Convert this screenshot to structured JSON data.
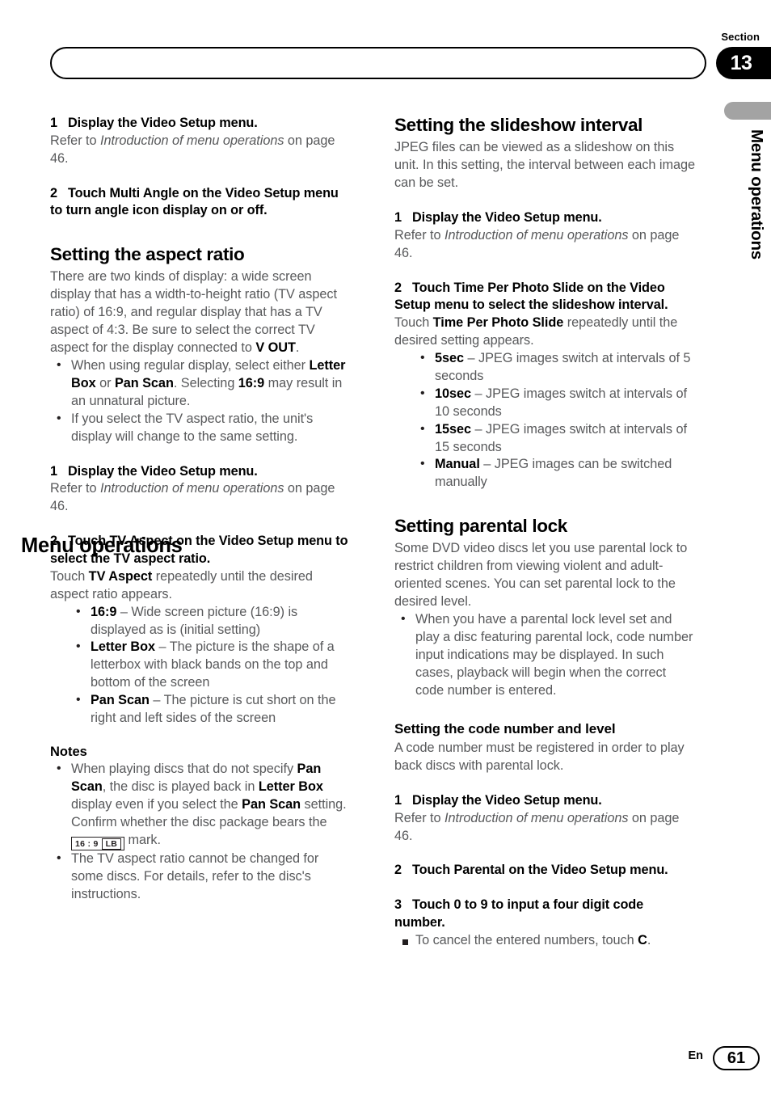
{
  "header": {
    "section_label": "Section",
    "section_number": "13",
    "title": "Menu operations",
    "side_tab_text": "Menu operations"
  },
  "footer": {
    "language": "En",
    "page_number": "61"
  },
  "left_column": {
    "step1_heading": "1    Display the Video Setup menu.",
    "step1_num": "1",
    "step1_text": "Display the Video Setup menu.",
    "step1_refer_pre": "Refer to ",
    "step1_refer_italic": "Introduction of menu operations",
    "step1_refer_post": " on page 46.",
    "step2_num": "2",
    "step2_text": "Touch Multi Angle on the Video Setup menu to turn angle icon display on or off.",
    "aspect_heading": "Setting the aspect ratio",
    "aspect_intro_a": "There are two kinds of display: a wide screen display that has a width-to-height ratio (TV aspect ratio) of 16:9, and regular display that has a TV aspect of 4:3. Be sure to select the correct TV aspect for the display connected to ",
    "aspect_intro_bold": "V OUT",
    "aspect_intro_b": ".",
    "bullet1_a": "When using regular display, select either ",
    "bullet1_b1": "Letter Box",
    "bullet1_c": " or ",
    "bullet1_b2": "Pan Scan",
    "bullet1_d": ". Selecting ",
    "bullet1_b3": "16:9",
    "bullet1_e": " may result in an unnatural picture.",
    "bullet2": "If you select the TV aspect ratio, the unit's display will change to the same setting.",
    "step1b_num": "1",
    "step1b_text": "Display the Video Setup menu.",
    "step1b_refer_pre": "Refer to ",
    "step1b_refer_italic": "Introduction of menu operations",
    "step1b_refer_post": " on page 46.",
    "step2b_num": "2",
    "step2b_text": "Touch TV Aspect on the Video Setup menu to select the TV aspect ratio.",
    "step2b_sub_a": "Touch ",
    "step2b_sub_bold": "TV Aspect",
    "step2b_sub_b": " repeatedly until the desired aspect ratio appears.",
    "options": [
      {
        "term": "16:9",
        "desc": " – Wide screen picture (16:9) is displayed as is (initial setting)"
      },
      {
        "term": "Letter Box",
        "desc": " – The picture is the shape of a letterbox with black bands on the top and bottom of the screen"
      },
      {
        "term": "Pan Scan",
        "desc": " – The picture is cut short on the right and left sides of the screen"
      }
    ],
    "notes_heading": "Notes",
    "note1_a": "When playing discs that do not specify ",
    "note1_b1": "Pan Scan",
    "note1_b": ", the disc is played back in ",
    "note1_b2": "Letter Box",
    "note1_c": " display even if you select the ",
    "note1_b3": "Pan Scan",
    "note1_d": " setting. Confirm whether the disc package bears the ",
    "note1_mark_ratio": "16 : 9",
    "note1_mark_lb": "LB",
    "note1_e": " mark.",
    "note2": "The TV aspect ratio cannot be changed for some discs. For details, refer to the disc's instructions."
  },
  "right_column": {
    "slideshow_heading": "Setting the slideshow interval",
    "slideshow_intro": "JPEG files can be viewed as a slideshow on this unit. In this setting, the interval between each image can be set.",
    "step1_num": "1",
    "step1_text": "Display the Video Setup menu.",
    "step1_refer_pre": "Refer to ",
    "step1_refer_italic": "Introduction of menu operations",
    "step1_refer_post": " on page 46.",
    "step2_num": "2",
    "step2_text": "Touch Time Per Photo Slide on the Video Setup menu to select the slideshow interval.",
    "step2_sub_a": "Touch ",
    "step2_sub_bold": "Time Per Photo Slide",
    "step2_sub_b": " repeatedly until the desired setting appears.",
    "intervals": [
      {
        "term": "5sec",
        "desc": " – JPEG images switch at intervals of 5 seconds"
      },
      {
        "term": "10sec",
        "desc": " – JPEG images switch at intervals of 10 seconds"
      },
      {
        "term": "15sec",
        "desc": " – JPEG images switch at intervals of 15 seconds"
      },
      {
        "term": "Manual",
        "desc": " – JPEG images can be switched manually"
      }
    ],
    "parental_heading": "Setting parental lock",
    "parental_intro": "Some DVD video discs let you use parental lock to restrict children from viewing violent and adult-oriented scenes. You can set parental lock to the desired level.",
    "parental_bullet": "When you have a parental lock level set and play a disc featuring parental lock, code number input indications may be displayed. In such cases, playback will begin when the correct code number is entered.",
    "code_heading": "Setting the code number and level",
    "code_intro": "A code number must be registered in order to play back discs with parental lock.",
    "code_step1_num": "1",
    "code_step1_text": "Display the Video Setup menu.",
    "code_step1_refer_pre": "Refer to ",
    "code_step1_refer_italic": "Introduction of menu operations",
    "code_step1_refer_post": " on page 46.",
    "code_step2_num": "2",
    "code_step2_text": "Touch Parental on the Video Setup menu.",
    "code_step3_num": "3",
    "code_step3_text": "Touch 0 to 9 to input a four digit code number.",
    "code_step3_note_a": "To cancel the entered numbers, touch ",
    "code_step3_note_bold": "C",
    "code_step3_note_b": "."
  }
}
